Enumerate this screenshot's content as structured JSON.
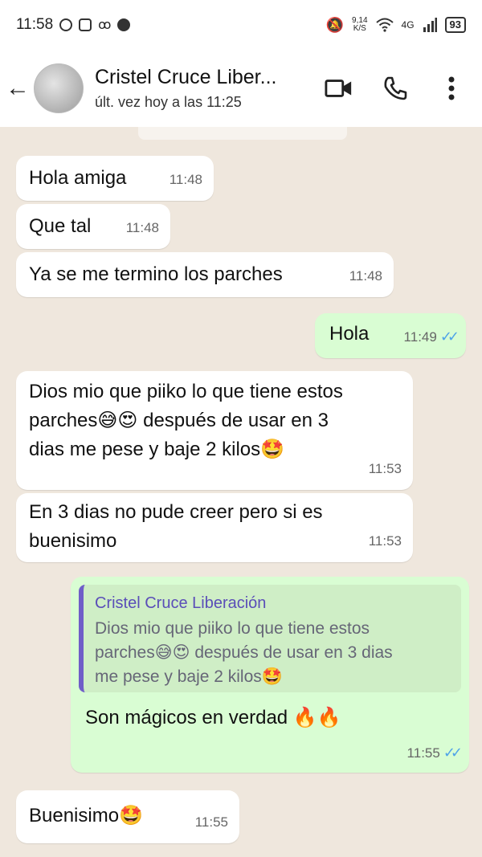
{
  "status_bar": {
    "time": "11:58",
    "speed_value": "9,14",
    "speed_unit": "K/S",
    "network": "4G",
    "battery": "93"
  },
  "header": {
    "contact_name": "Cristel Cruce Liber...",
    "last_seen": "últ. vez hoy a las 11:25"
  },
  "messages": [
    {
      "text": "Hola amiga",
      "time": "11:48"
    },
    {
      "text": "Que tal",
      "time": "11:48"
    },
    {
      "text": "Ya se me termino los parches",
      "time": "11:48"
    },
    {
      "text": "Hola",
      "time": "11:49"
    },
    {
      "line1": "Dios mio que piiko lo que tiene estos",
      "line2": "parches😅😍 después de usar en 3",
      "line3": "dias me pese y baje 2 kilos🤩",
      "time": "11:53"
    },
    {
      "line1": "En 3 dias no pude creer pero si es",
      "line2": "buenisimo",
      "time": "11:53"
    },
    {
      "quote_author": "Cristel Cruce Liberación",
      "quote_line1": "Dios mio que piiko lo que tiene estos",
      "quote_line2": "parches😅😍 después de usar en 3 dias",
      "quote_line3": "me pese y baje 2 kilos🤩",
      "text": "Son mágicos en verdad  🔥🔥",
      "time": "11:55"
    },
    {
      "text": "Buenisimo🤩",
      "time": "11:55"
    }
  ],
  "colors": {
    "outgoing_bubble": "#d9fdd3",
    "incoming_bubble": "#ffffff",
    "chat_background": "#efe7dd",
    "read_ticks": "#4fa3e8",
    "quote_bar": "#6f5ec8"
  }
}
